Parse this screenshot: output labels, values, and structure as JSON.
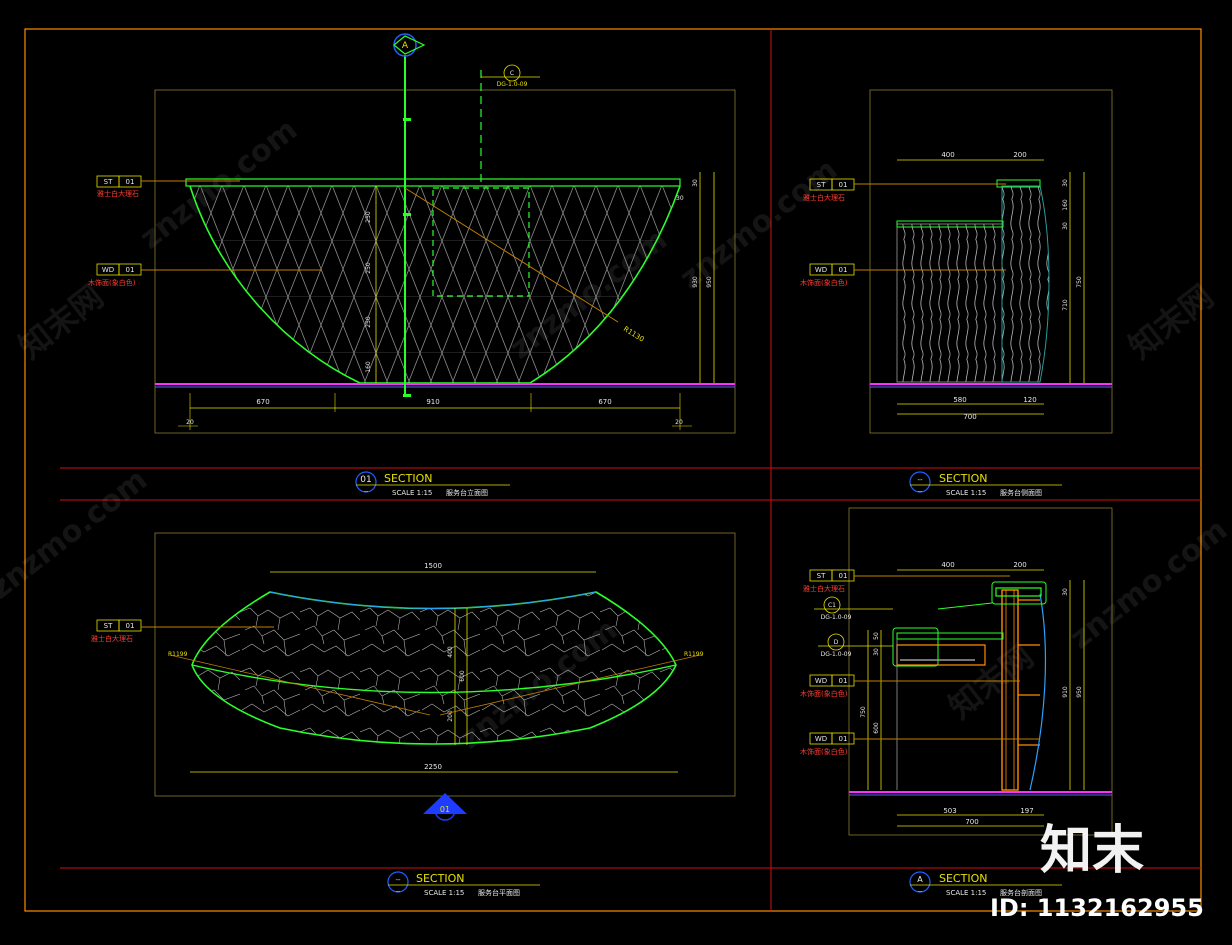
{
  "watermark": {
    "text": "znzmo.com",
    "logo": "知末网"
  },
  "brand": {
    "logo": "知末",
    "id": "ID: 1132162955"
  },
  "views": {
    "front": {
      "markers": {
        "top": "A",
        "ref_top": "C",
        "ref_code": "DG-1.0-09"
      },
      "tags": [
        {
          "code": "ST",
          "num": "01",
          "desc": "雅士白大理石"
        },
        {
          "code": "WD",
          "num": "01",
          "desc": "木饰面(象白色)"
        }
      ],
      "dims_bottom": [
        "670",
        "910",
        "670"
      ],
      "dims_small": [
        "20",
        "20"
      ],
      "dims_vertical": [
        "250",
        "250",
        "250",
        "160"
      ],
      "dims_right": [
        "30",
        "930",
        "950",
        "30"
      ],
      "radius": "R1130",
      "title": {
        "num": "01",
        "sub": "--",
        "section": "SECTION",
        "scale": "SCALE 1:15",
        "name": "服务台立面图"
      }
    },
    "side": {
      "tags": [
        {
          "code": "ST",
          "num": "01",
          "desc": "雅士白大理石"
        },
        {
          "code": "WD",
          "num": "01",
          "desc": "木饰面(象白色)"
        }
      ],
      "dims_top": [
        "400",
        "200"
      ],
      "dims_bottom": [
        "580",
        "120",
        "700"
      ],
      "dims_right": [
        "30",
        "160",
        "30",
        "750",
        "710"
      ],
      "title": {
        "num": "--",
        "sub": "--",
        "section": "SECTION",
        "scale": "SCALE 1:15",
        "name": "服务台侧面图"
      }
    },
    "plan": {
      "tags": [
        {
          "code": "ST",
          "num": "01",
          "desc": "雅士白大理石"
        }
      ],
      "dims": {
        "top": "1500",
        "bottom": "2250",
        "v1": "400",
        "v2": "600",
        "v3": "200",
        "r_left": "R1199",
        "r_right": "R1199"
      },
      "marker": "01",
      "title": {
        "num": "--",
        "sub": "--",
        "section": "SECTION",
        "scale": "SCALE 1:15",
        "name": "服务台平面图"
      }
    },
    "detail": {
      "tags": [
        {
          "code": "ST",
          "num": "01",
          "desc": "雅士白大理石"
        },
        {
          "code": "WD",
          "num": "01",
          "desc": "木饰面(象白色)"
        },
        {
          "code": "WD",
          "num": "01",
          "desc": "木饰面(象白色)"
        }
      ],
      "refs": [
        {
          "code": "C1",
          "sheet": "DG-1.0-09"
        },
        {
          "code": "D",
          "sheet": "DG-1.0-09"
        }
      ],
      "dims_top": [
        "400",
        "200"
      ],
      "dims_left": [
        "50",
        "30",
        "750",
        "600"
      ],
      "dims_right": [
        "30",
        "910",
        "950"
      ],
      "dims_bottom": [
        "503",
        "197",
        "700"
      ],
      "title": {
        "num": "A",
        "sub": "--",
        "section": "SECTION",
        "scale": "SCALE 1:15",
        "name": "服务台剖面图"
      }
    }
  }
}
